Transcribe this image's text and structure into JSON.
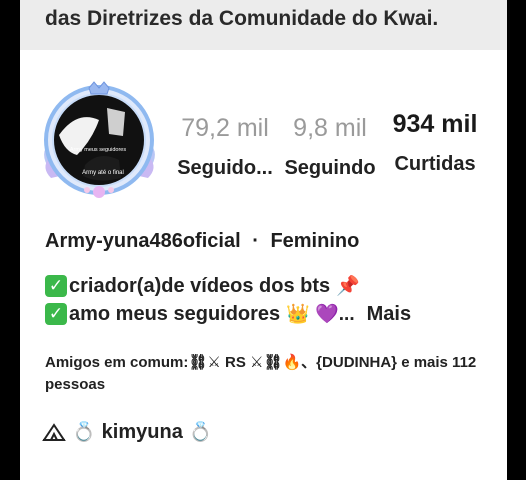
{
  "banner": {
    "text": "das Diretrizes da Comunidade do Kwai."
  },
  "avatar": {
    "text_top": "Army meus seguidores",
    "text_bottom": "Army até o final"
  },
  "stats": [
    {
      "value": "79,2 mil",
      "label": "Seguido..."
    },
    {
      "value": "9,8 mil",
      "label": "Seguindo"
    },
    {
      "value": "934 mil",
      "label": "Curtidas"
    }
  ],
  "profile": {
    "name": "Army-yuna486oficial",
    "separator": "·",
    "gender": "Feminino"
  },
  "bio": {
    "check_glyph": "✓",
    "line1": "criador(a)de vídeos dos bts",
    "line1_emoji": "📌",
    "line2": "amo meus seguidores",
    "line2_emoji": "👑 💜...",
    "more_label": "Mais"
  },
  "friends": {
    "text": "Amigos em comum:⛓⚔ RS ⚔⛓🔥、{DUDINHA} e mais 112 pessoas"
  },
  "linked_account": {
    "name": "kimyuna",
    "ring_glyph": "💍"
  },
  "colors": {
    "accent_check": "#3bb84a",
    "avatar_ring": "#8fb9f0",
    "muted_count": "#9a9a9a"
  },
  "icons": [
    "tent-icon",
    "ring-icon",
    "check-icon",
    "pin-icon",
    "crown-icon",
    "heart-icon"
  ]
}
